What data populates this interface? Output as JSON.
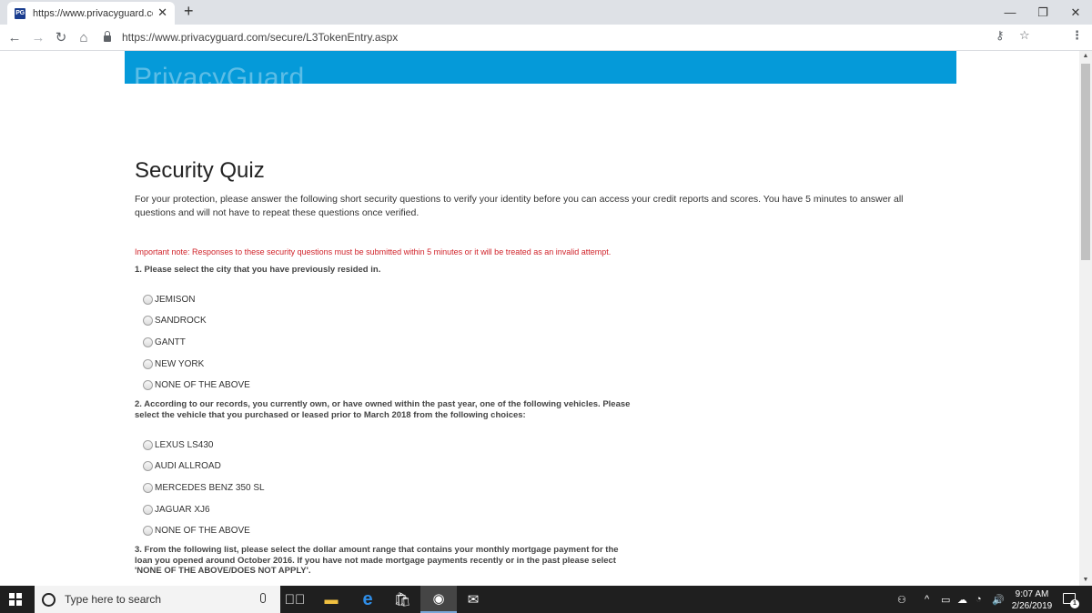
{
  "browser": {
    "tab_title": "https://www.privacyguard.com/s",
    "favicon_text": "PG",
    "url": "https://www.privacyguard.com/secure/L3TokenEntry.aspx"
  },
  "site": {
    "logo_text": "PrivacyGuard",
    "banner_color": "#059ad9"
  },
  "page": {
    "title": "Security Quiz",
    "intro": "For your protection, please answer the following short security questions to verify your identity before you can access your credit reports and scores. You have 5 minutes to answer all questions and will not have to repeat these questions once verified.",
    "important_note": "Important note: Responses to these security questions must be submitted within 5 minutes or it will be treated as an invalid attempt.",
    "questions": [
      {
        "text": "1. Please select the city that you have previously resided in.",
        "options": [
          "JEMISON",
          "SANDROCK",
          "GANTT",
          "NEW YORK",
          "NONE OF THE ABOVE"
        ]
      },
      {
        "text": "2. According to our records, you currently own, or have owned within the past year, one of the following vehicles. Please select the vehicle that you purchased or leased prior to March 2018 from the following choices:",
        "options": [
          "LEXUS LS430",
          "AUDI ALLROAD",
          "MERCEDES BENZ 350 SL",
          "JAGUAR XJ6",
          "NONE OF THE ABOVE"
        ]
      },
      {
        "text": "3. From the following list, please select the dollar amount range that contains your monthly mortgage payment for the loan you opened around October 2016. If you have not made mortgage payments recently or in the past please select 'NONE OF THE ABOVE/DOES NOT APPLY'."
      }
    ]
  },
  "taskbar": {
    "search_placeholder": "Type here to search",
    "time": "9:07 AM",
    "date": "2/26/2019",
    "notification_count": "1"
  }
}
